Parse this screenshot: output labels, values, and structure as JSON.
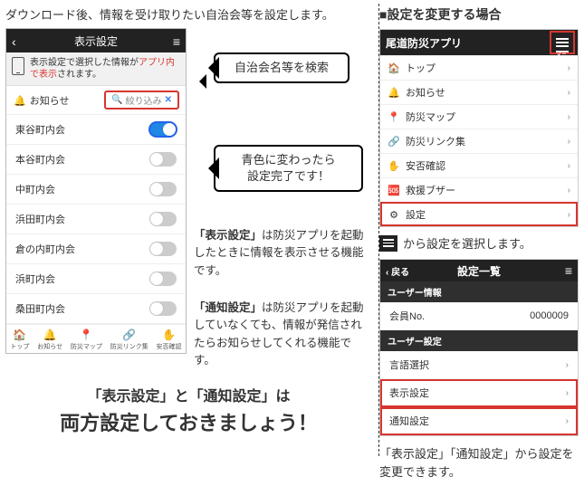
{
  "left": {
    "intro": "ダウンロード後、情報を受け取りたい自治会等を設定します。",
    "phone": {
      "title": "表示設定",
      "back": "‹",
      "menu": "≡",
      "notice_prefix": "表示設定で選択した情報が",
      "notice_red1": "アプリ内で",
      "notice_red2": "表示",
      "notice_suffix": "されます。",
      "section_label": "お知らせ",
      "search_placeholder": "絞り込み",
      "associations": [
        {
          "name": "東谷町内会",
          "on": true,
          "highlight": true
        },
        {
          "name": "本谷町内会",
          "on": false,
          "highlight": false
        },
        {
          "name": "中町内会",
          "on": false,
          "highlight": false
        },
        {
          "name": "浜田町内会",
          "on": false,
          "highlight": false
        },
        {
          "name": "倉の内町内会",
          "on": false,
          "highlight": false
        },
        {
          "name": "浜町内会",
          "on": false,
          "highlight": false
        },
        {
          "name": "桑田町内会",
          "on": false,
          "highlight": false
        }
      ],
      "tabs": [
        {
          "icon": "🏠",
          "label": "トップ"
        },
        {
          "icon": "🔔",
          "label": "お知らせ"
        },
        {
          "icon": "📍",
          "label": "防災マップ"
        },
        {
          "icon": "🔗",
          "label": "防災リンク集"
        },
        {
          "icon": "✋",
          "label": "安否確認"
        }
      ]
    },
    "bubble1": "自治会名等を検索",
    "bubble2_line1": "青色に変わったら",
    "bubble2_line2": "設定完了です！",
    "explain1_hl": "「表示設定」",
    "explain1_rest": "は防災アプリを起動したときに情報を表示させる機能です。",
    "explain2_hl": "「通知設定」",
    "explain2_rest": "は防災アプリを起動していなくても、情報が発信されたらお知らせしてくれる機能です。",
    "big_line1": "「表示設定」と「通知設定」は",
    "big_line2": "両方設定しておきましょう！"
  },
  "right": {
    "heading": "■設定を変更する場合",
    "app_title": "尾道防災アプリ",
    "menu_caption": "メニュー",
    "menu_items": [
      {
        "icon": "🏠",
        "label": "トップ"
      },
      {
        "icon": "🔔",
        "label": "お知らせ"
      },
      {
        "icon": "📍",
        "label": "防災マップ"
      },
      {
        "icon": "🔗",
        "label": "防災リンク集"
      },
      {
        "icon": "✋",
        "label": "安否確認"
      },
      {
        "icon": "🆘",
        "label": "救援ブザー"
      },
      {
        "icon": "⚙",
        "label": "設定",
        "highlight": true
      }
    ],
    "note1": "から設定を選択します。",
    "settings": {
      "back_label": "戻る",
      "title": "設定一覧",
      "section1": "ユーザー情報",
      "row1_label": "会員No.",
      "row1_value": "0000009",
      "section2": "ユーザー設定",
      "rows2": [
        {
          "label": "言語選択",
          "highlight": false
        },
        {
          "label": "表示設定",
          "highlight": true
        },
        {
          "label": "通知設定",
          "highlight": true
        }
      ]
    },
    "note2": "「表示設定」「通知設定」から設定を変更できます。"
  }
}
